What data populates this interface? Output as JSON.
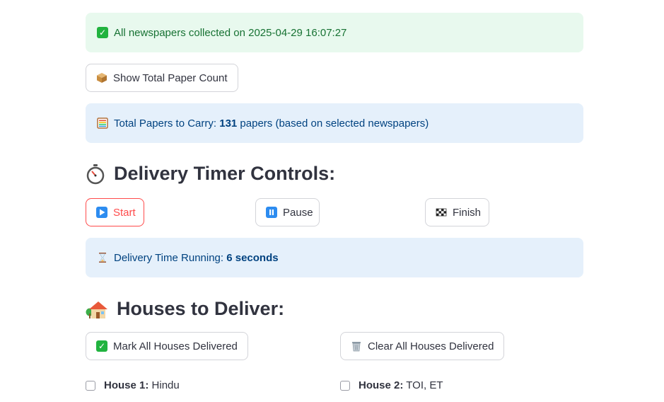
{
  "success_alert": {
    "icon": "check-mark-button-icon",
    "text": "All newspapers collected on 2025-04-29 16:07:27"
  },
  "show_count_button": {
    "icon": "package-icon",
    "label": "Show Total Paper Count"
  },
  "total_alert": {
    "icon": "abacus-icon",
    "prefix": "Total Papers to Carry: ",
    "count": "131",
    "suffix": " papers (based on selected newspapers)"
  },
  "timer_section": {
    "icon": "stopwatch-icon",
    "title": "Delivery Timer Controls:",
    "start_label": "Start",
    "pause_label": "Pause",
    "finish_label": "Finish"
  },
  "running_alert": {
    "icon": "hourglass-icon",
    "prefix": "Delivery Time Running: ",
    "value": "6 seconds"
  },
  "houses_section": {
    "icon": "house-with-garden-icon",
    "title": "Houses to Deliver:",
    "mark_all_label": "Mark All Houses Delivered",
    "clear_all_label": "Clear All Houses Delivered",
    "houses": [
      {
        "name": "House 1:",
        "papers": " Hindu",
        "checked": false
      },
      {
        "name": "House 2:",
        "papers": " TOI, ET",
        "checked": false
      }
    ]
  },
  "colors": {
    "accent": "#ff4b4b",
    "success_bg": "#e8f9ee",
    "info_bg": "#e5f0fb"
  }
}
